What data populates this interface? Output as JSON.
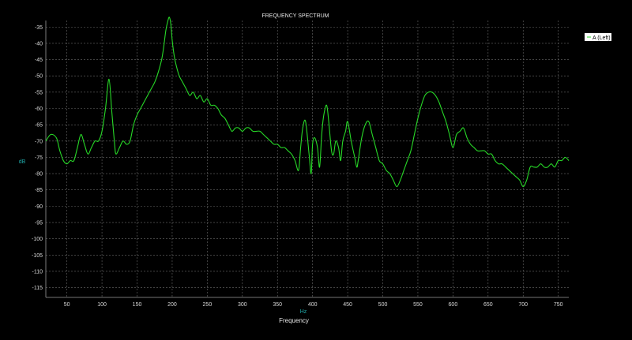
{
  "chart_data": {
    "type": "line",
    "title": "FREQUENCY SPECTRUM",
    "xlabel": "Frequency",
    "x_unit": "Hz",
    "y_unit": "dB",
    "xlim": [
      20,
      765
    ],
    "ylim": [
      -118,
      -33
    ],
    "xticks": [
      50,
      100,
      150,
      200,
      250,
      300,
      350,
      400,
      450,
      500,
      550,
      600,
      650,
      700,
      750
    ],
    "yticks": [
      -35,
      -40,
      -45,
      -50,
      -55,
      -60,
      -65,
      -70,
      -75,
      -80,
      -85,
      -90,
      -95,
      -100,
      -105,
      -110,
      -115
    ],
    "grid": true,
    "legend_position": "top-right",
    "series": [
      {
        "name": "A (Left)",
        "color": "#27d827",
        "x": [
          20,
          27,
          35,
          40,
          45,
          50,
          55,
          60,
          65,
          70,
          75,
          80,
          85,
          90,
          95,
          100,
          105,
          110,
          114,
          118,
          120,
          125,
          130,
          135,
          140,
          145,
          150,
          155,
          160,
          165,
          170,
          175,
          180,
          185,
          188,
          191,
          194,
          196,
          198,
          200,
          203,
          206,
          210,
          215,
          220,
          225,
          230,
          235,
          240,
          245,
          250,
          255,
          260,
          265,
          270,
          275,
          280,
          285,
          290,
          295,
          300,
          305,
          310,
          315,
          320,
          325,
          330,
          335,
          340,
          345,
          350,
          355,
          360,
          365,
          370,
          375,
          380,
          383,
          386,
          390,
          395,
          398,
          400,
          403,
          407,
          410,
          413,
          416,
          420,
          423,
          427,
          430,
          433,
          437,
          440,
          443,
          447,
          450,
          455,
          460,
          463,
          465,
          470,
          475,
          480,
          485,
          490,
          495,
          500,
          505,
          510,
          515,
          520,
          525,
          530,
          535,
          540,
          545,
          550,
          555,
          560,
          565,
          570,
          575,
          580,
          585,
          590,
          595,
          600,
          605,
          610,
          615,
          620,
          625,
          630,
          635,
          640,
          645,
          650,
          655,
          660,
          665,
          670,
          675,
          680,
          685,
          690,
          695,
          700,
          705,
          710,
          715,
          720,
          725,
          730,
          735,
          740,
          745,
          750,
          755,
          760,
          765
        ],
        "y": [
          -70,
          -68,
          -69,
          -73,
          -76,
          -77,
          -76,
          -76,
          -72,
          -68,
          -71,
          -74,
          -72,
          -70,
          -70,
          -67,
          -60,
          -51,
          -61,
          -71,
          -74,
          -72,
          -70,
          -71,
          -70,
          -65,
          -62,
          -60,
          -58,
          -56,
          -54,
          -52,
          -49,
          -45,
          -41,
          -36,
          -33,
          -32,
          -34,
          -39,
          -44,
          -47,
          -50,
          -52,
          -54,
          -56,
          -55,
          -57,
          -56,
          -58,
          -57,
          -59,
          -59,
          -60,
          -62,
          -63,
          -65,
          -67,
          -66,
          -66,
          -67,
          -66,
          -66,
          -67,
          -67,
          -67,
          -68,
          -69,
          -70,
          -71,
          -71,
          -72,
          -72,
          -73,
          -74,
          -76,
          -79,
          -72,
          -66,
          -64,
          -74,
          -80,
          -71,
          -69,
          -72,
          -78,
          -68,
          -62,
          -59,
          -64,
          -73,
          -74,
          -70,
          -72,
          -76,
          -70,
          -67,
          -64,
          -70,
          -75,
          -78,
          -76,
          -69,
          -65,
          -64,
          -68,
          -72,
          -76,
          -77,
          -79,
          -80,
          -82,
          -84,
          -82,
          -79,
          -76,
          -73,
          -68,
          -63,
          -59,
          -56,
          -55,
          -55,
          -56,
          -58,
          -61,
          -64,
          -68,
          -72,
          -68,
          -67,
          -66,
          -69,
          -71,
          -72,
          -73,
          -73,
          -73,
          -74,
          -74,
          -76,
          -77,
          -77,
          -78,
          -79,
          -80,
          -81,
          -82,
          -84,
          -82,
          -78,
          -78,
          -78,
          -77,
          -78,
          -78,
          -77,
          -78,
          -76,
          -76,
          -75,
          -76
        ]
      }
    ]
  }
}
